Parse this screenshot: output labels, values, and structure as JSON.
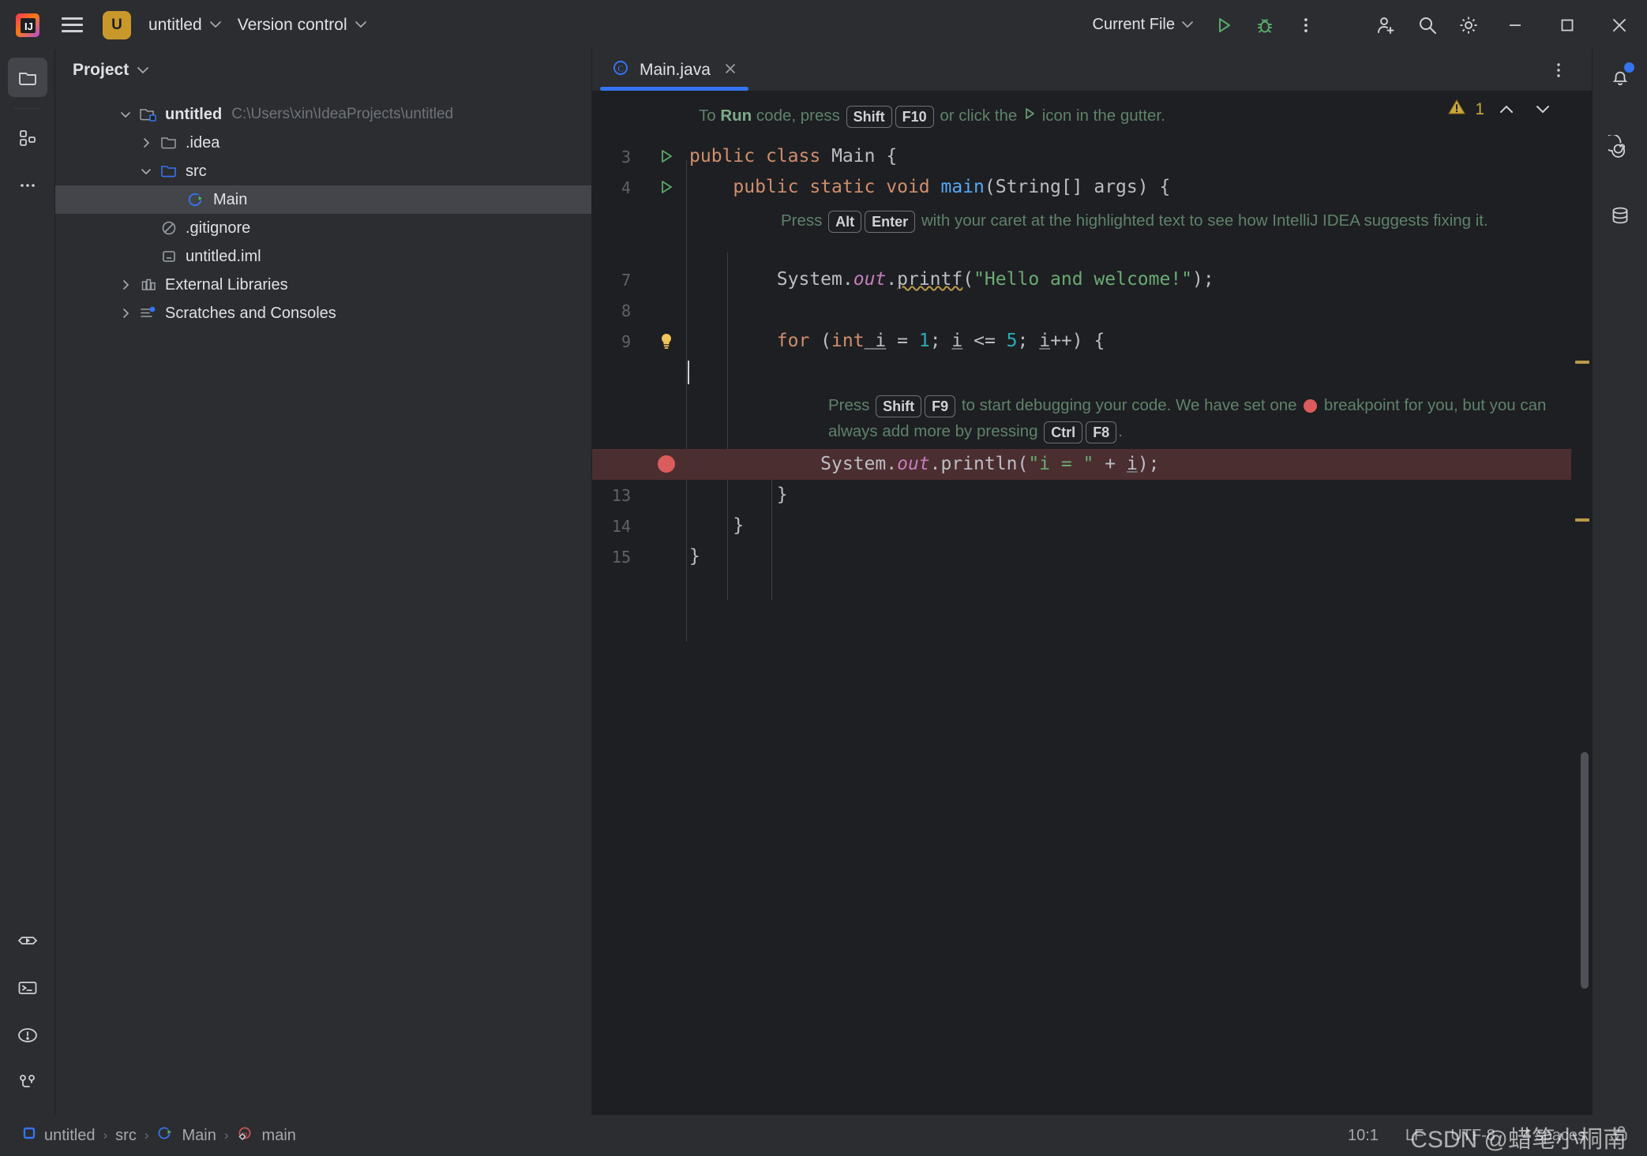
{
  "titlebar": {
    "logo_icon": "intellij-idea-logo-icon",
    "menu_icon": "hamburger-menu-icon",
    "project_badge": "U",
    "project_name": "untitled",
    "version_control": "Version control",
    "run_config": "Current File",
    "run_icon": "run-play-icon",
    "debug_icon": "debug-bug-icon",
    "more_icon": "more-vertical-icon",
    "account_icon": "add-user-icon",
    "search_icon": "search-icon",
    "settings_icon": "gear-icon",
    "minimize_icon": "minimize-icon",
    "maximize_icon": "maximize-icon",
    "close_icon": "close-icon"
  },
  "left_strip": {
    "items": [
      {
        "name": "project-tool-window",
        "icon": "folder-icon",
        "active": true
      },
      {
        "name": "commit-tool-window",
        "icon": "structure-blocks-icon",
        "active": false
      },
      {
        "name": "more-tool-windows",
        "icon": "ellipsis-icon",
        "active": false
      }
    ],
    "bottom_items": [
      {
        "name": "run-tool-window",
        "icon": "run-window-icon"
      },
      {
        "name": "terminal-tool-window",
        "icon": "terminal-icon"
      },
      {
        "name": "problems-tool-window",
        "icon": "warning-circle-icon"
      },
      {
        "name": "version-control-tool-window",
        "icon": "branch-icon"
      }
    ]
  },
  "project_panel": {
    "title": "Project",
    "title_chevron": "chevron-down-icon",
    "tree": [
      {
        "label": "untitled",
        "path": "C:\\Users\\xin\\IdeaProjects\\untitled",
        "icon": "module-folder-icon",
        "twist": "chevron-down-icon",
        "indent": 0,
        "bold": true,
        "selected": false
      },
      {
        "label": ".idea",
        "path": "",
        "icon": "folder-icon",
        "twist": "chevron-right-icon",
        "indent": 1,
        "bold": false,
        "selected": false
      },
      {
        "label": "src",
        "path": "",
        "icon": "source-folder-icon",
        "twist": "chevron-down-icon",
        "indent": 1,
        "bold": false,
        "selected": false
      },
      {
        "label": "Main",
        "path": "",
        "icon": "java-class-runnable-icon",
        "twist": "",
        "indent": 2,
        "bold": false,
        "selected": true
      },
      {
        "label": ".gitignore",
        "path": "",
        "icon": "gitignore-icon",
        "twist": "",
        "indent": 1,
        "bold": false,
        "selected": false
      },
      {
        "label": "untitled.iml",
        "path": "",
        "icon": "iml-file-icon",
        "twist": "",
        "indent": 1,
        "bold": false,
        "selected": false
      },
      {
        "label": "External Libraries",
        "path": "",
        "icon": "libraries-icon",
        "twist": "chevron-right-icon",
        "indent": 0,
        "bold": false,
        "selected": false
      },
      {
        "label": "Scratches and Consoles",
        "path": "",
        "icon": "scratches-icon",
        "twist": "chevron-right-icon",
        "indent": 0,
        "bold": false,
        "selected": false
      }
    ]
  },
  "editor": {
    "tab": {
      "label": "Main.java",
      "icon": "java-class-icon",
      "close_icon": "close-icon",
      "active": true
    },
    "tab_actions_icon": "more-vertical-icon",
    "inspection": {
      "warning_count": "1",
      "warning_icon": "warning-triangle-icon",
      "prev_icon": "chevron-up-icon",
      "next_icon": "chevron-down-icon"
    },
    "hints": {
      "run_hint": {
        "prefix": "To ",
        "bold1": "Run",
        "mid1": " code, press ",
        "key1": "Shift",
        "key2": "F10",
        "mid2": " or click the ",
        "play_icon": "run-play-icon",
        "suffix": " icon in the gutter."
      },
      "altenter_hint": {
        "prefix": "Press ",
        "key1": "Alt",
        "key2": "Enter",
        "suffix": " with your caret at the highlighted text to see how IntelliJ IDEA suggests fixing it."
      },
      "debug_hint": {
        "prefix": "Press ",
        "key1": "Shift",
        "key2": "F9",
        "mid1": " to start debugging your code. We have set one ",
        "breakpoint_icon": "breakpoint-dot-icon",
        "mid2": " breakpoint for you, but you can always add more by pressing ",
        "key3": "Ctrl",
        "key4": "F8",
        "suffix": "."
      }
    },
    "lines": [
      {
        "num": "3",
        "gutter": "run-play-icon",
        "code_id": "l3"
      },
      {
        "num": "4",
        "gutter": "run-play-icon",
        "code_id": "l4"
      },
      {
        "num": "7",
        "gutter": "",
        "code_id": "l7"
      },
      {
        "num": "8",
        "gutter": "",
        "code_id": "l8"
      },
      {
        "num": "9",
        "gutter": "bulb-icon",
        "code_id": "l9"
      },
      {
        "num": "",
        "gutter": "",
        "code_id": "lblank"
      },
      {
        "num": "",
        "gutter": "breakpoint-dot-icon",
        "code_id": "l12"
      },
      {
        "num": "13",
        "gutter": "",
        "code_id": "l13"
      },
      {
        "num": "14",
        "gutter": "",
        "code_id": "l14"
      },
      {
        "num": "15",
        "gutter": "",
        "code_id": "l15"
      }
    ],
    "code": {
      "l3_kw1": "public",
      "l3_kw2": "class",
      "l3_name": "Main",
      "l3_brace": "{",
      "l4_kw": "public static void ",
      "l4_fn": "main",
      "l4_rest": "(String[] args) {",
      "l7_sys": "System.",
      "l7_out": "out",
      "l7_dot": ".",
      "l7_printf": "printf",
      "l7_open": "(",
      "l7_str": "\"Hello and welcome!\"",
      "l7_close": ");",
      "l9_for": "for",
      "l9_p1": " (",
      "l9_int": "int",
      "l9_i1": " i",
      "l9_eq": " = ",
      "l9_n1": "1",
      "l9_semi1": "; ",
      "l9_i2": "i",
      "l9_le": " <= ",
      "l9_n2": "5",
      "l9_semi2": "; ",
      "l9_i3": "i",
      "l9_inc": "++) {",
      "l12_sys": "System.",
      "l12_out": "out",
      "l12_dot": ".",
      "l12_println": "println",
      "l12_open": "(",
      "l12_str": "\"i = \"",
      "l12_plus": " + ",
      "l12_i": "i",
      "l12_close": ");",
      "l13": "}",
      "l14": "}",
      "l15": "}"
    }
  },
  "right_strip": {
    "items": [
      {
        "name": "notifications-tool-window",
        "icon": "bell-icon",
        "badge": true
      },
      {
        "name": "ai-assistant-tool-window",
        "icon": "spiral-icon",
        "badge": false
      },
      {
        "name": "database-tool-window",
        "icon": "database-icon",
        "badge": false
      }
    ]
  },
  "statusbar": {
    "breadcrumbs": [
      {
        "label": "untitled",
        "icon": "module-square-icon"
      },
      {
        "label": "src",
        "icon": ""
      },
      {
        "label": "Main",
        "icon": "java-class-runnable-icon"
      },
      {
        "label": "main",
        "icon": "method-icon"
      }
    ],
    "separator": "›",
    "caret_position": "10:1",
    "line_separator": "LF",
    "encoding": "UTF-8",
    "indent": "4 spaces",
    "lock_icon": "unlock-icon",
    "watermark": "CSDN @蜡笔小桐南"
  },
  "colors": {
    "accent_blue": "#3574f0",
    "run_green": "#59a869",
    "warning_yellow": "#c8a93a",
    "breakpoint_red": "#db5c5c",
    "badge_gold": "#c8992a",
    "hint_green": "#5f826b",
    "highlight_line": "#4b2e30"
  }
}
